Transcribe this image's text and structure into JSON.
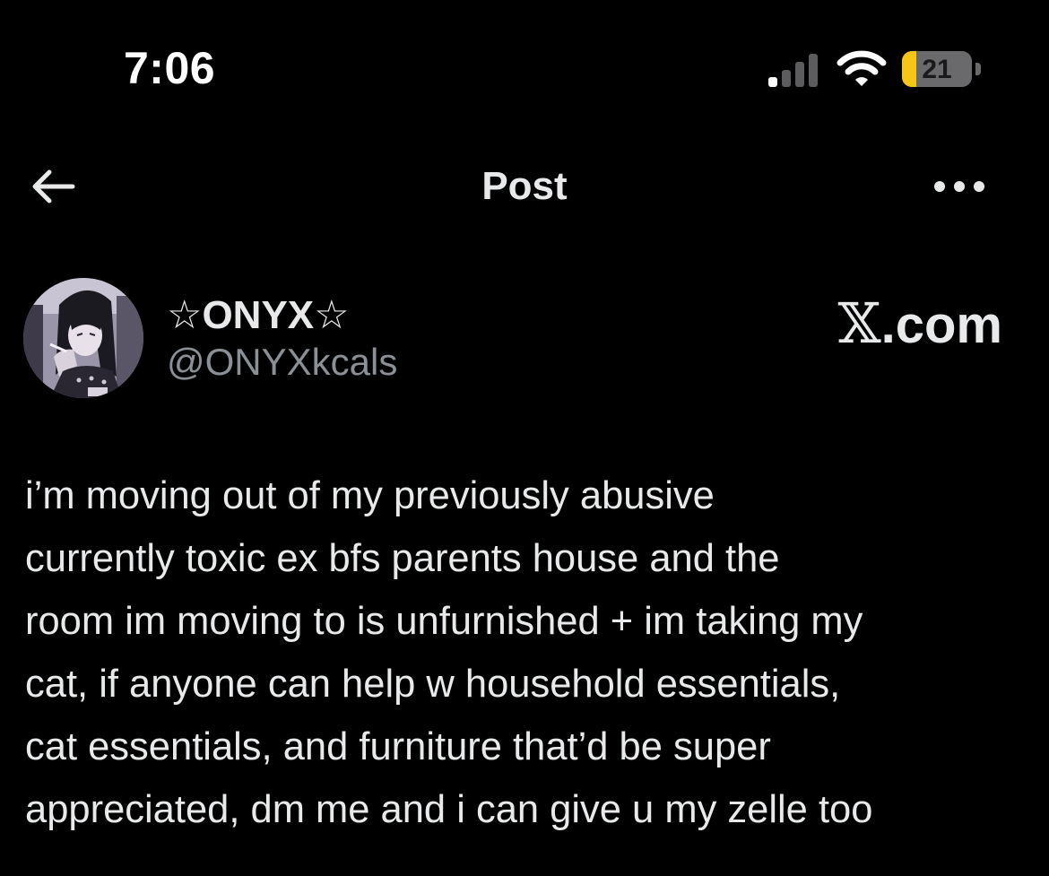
{
  "status_bar": {
    "time": "7:06",
    "battery_level": "21",
    "battery_fraction": 0.21,
    "battery_color": "#f5c518",
    "signal_icon": "cellular-signal-icon",
    "wifi_icon": "wifi-icon"
  },
  "header": {
    "title": "Post",
    "back_icon": "arrow-left-icon",
    "more_icon": "ellipsis-icon"
  },
  "author": {
    "display_name": "☆ONYX☆",
    "handle": "@ONYXkcals",
    "avatar_icon": "avatar-illustration"
  },
  "watermark": {
    "symbol": "𝕏",
    "suffix": ".com"
  },
  "post": {
    "lines": [
      "i’m moving out of my previously abusive",
      "currently toxic ex bfs parents house and the",
      "room im moving to is unfurnished + im taking my",
      "cat, if anyone can help w household essentials,",
      "cat essentials, and furniture that’d be super",
      "appreciated, dm me and i can give u my zelle too"
    ]
  },
  "colors": {
    "background": "#000000",
    "text_primary": "#e7e9ea",
    "text_secondary": "#8b9096"
  }
}
